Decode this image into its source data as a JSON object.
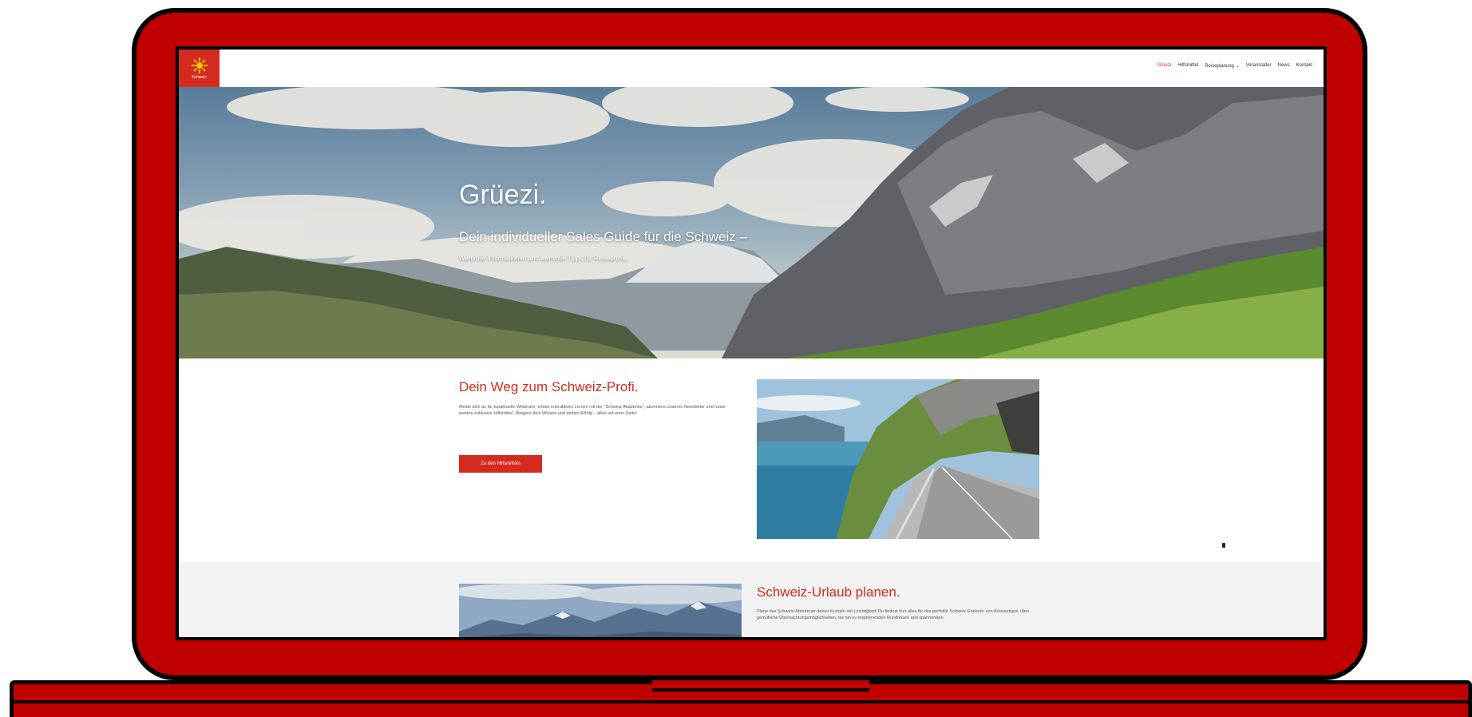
{
  "brand": {
    "logo_text": "Schweiz",
    "accent": "#d52b1e",
    "frame_color": "#c00000"
  },
  "nav": {
    "items": [
      {
        "label": "Grüezi",
        "active": true
      },
      {
        "label": "Hilfsmittel",
        "active": false
      },
      {
        "label": "Reiseplanung ⌄",
        "active": false
      },
      {
        "label": "Veranstalter",
        "active": false
      },
      {
        "label": "News",
        "active": false
      },
      {
        "label": "Kontakt",
        "active": false
      }
    ]
  },
  "hero": {
    "title": "Grüezi.",
    "subtitle": "Dein individueller Sales Guide für die Schweiz –",
    "tagline": "Wertvolle Informationen und wertvolle Tipps für Reiseprofis."
  },
  "section1": {
    "title": "Dein Weg zum Schweiz-Profi.",
    "text": "Melde dich an für topaktuelle Webinare, erlebe interaktives Lernen mit der \"Schweiz Akademie\", abonniere unseren Newsletter und nutze weitere exklusive Hilfsmittel. Steigere dein Wissen und deinen Erfolg – alles auf einer Seite!",
    "button_label": "Zu den Hilfsmitteln",
    "image_icon": "lake-road-photo"
  },
  "section2": {
    "title": "Schweiz-Urlaub planen.",
    "text": "Plane das Schweiz-Abenteuer deiner Kunden mit Leichtigkeit! Du findest hier alles für das perfekte Schweiz-Erlebnis: von Anreisetipps, über gemütliche Übernachtungsmöglichkeiten, bis hin zu inspirierenden Rundreisen und spannenden",
    "image_icon": "mountain-panorama-photo"
  }
}
